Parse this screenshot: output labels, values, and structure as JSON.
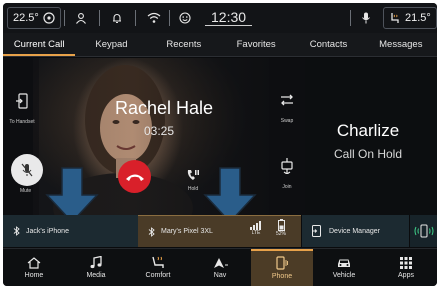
{
  "status_bar": {
    "outside_temp": "22.5°",
    "clock": "12:30",
    "cabin_temp": "21.5°"
  },
  "tabs": [
    {
      "label": "Current Call",
      "active": true
    },
    {
      "label": "Keypad"
    },
    {
      "label": "Recents"
    },
    {
      "label": "Favorites"
    },
    {
      "label": "Contacts"
    },
    {
      "label": "Messages"
    }
  ],
  "call": {
    "active_caller": "Rachel Hale",
    "duration": "03:25",
    "held_caller": "Charlize",
    "held_status": "Call On Hold"
  },
  "controls": {
    "to_handset": "To Handset",
    "mute": "Mute",
    "hold": "Hold",
    "swap": "Swap",
    "join": "Join"
  },
  "devices": {
    "device1": "Jack's iPhone",
    "device2": "Mary's Pixel 3XL",
    "device2_network": "LTE",
    "device2_battery": "52%",
    "device_manager": "Device Manager"
  },
  "nav": [
    {
      "label": "Home",
      "icon": "home-icon"
    },
    {
      "label": "Media",
      "icon": "music-note-icon"
    },
    {
      "label": "Comfort",
      "icon": "seat-icon"
    },
    {
      "label": "Nav",
      "icon": "navigation-arrow-icon"
    },
    {
      "label": "Phone",
      "icon": "phone-icon",
      "active": true
    },
    {
      "label": "Vehicle",
      "icon": "car-icon"
    },
    {
      "label": "Apps",
      "icon": "apps-grid-icon"
    }
  ],
  "colors": {
    "accent": "#e8a24a",
    "end_call": "#d9202a",
    "device_selected": "#4a3b27",
    "device_bar": "#1c2a31",
    "wireless_icon": "#3fd08a"
  }
}
